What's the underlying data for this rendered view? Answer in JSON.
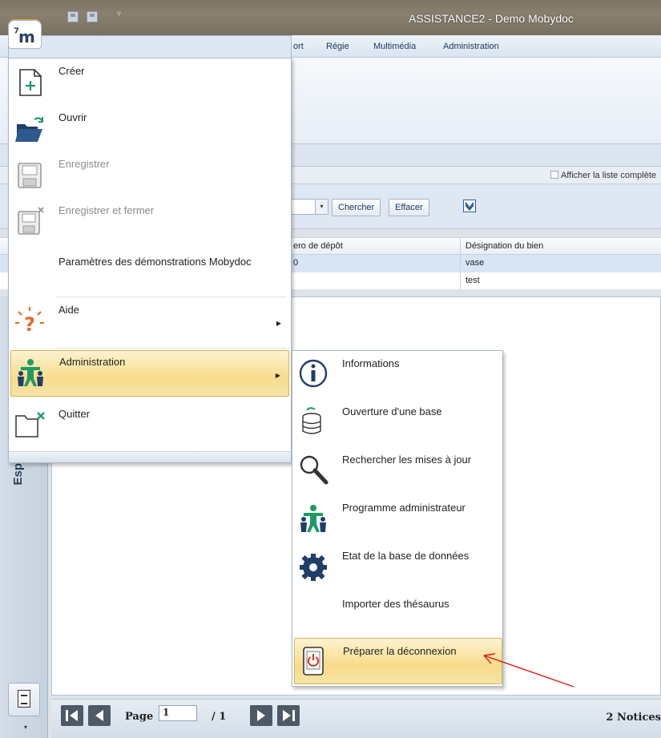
{
  "window": {
    "title": "ASSISTANCE2 - Demo Mobydoc"
  },
  "ribbon": {
    "tabs": [
      "ort",
      "Régie",
      "Multimédia",
      "Administration"
    ]
  },
  "filters": {
    "show_all_label": "Afficher la liste complète",
    "search_label": "Chercher",
    "clear_label": "Effacer"
  },
  "grid": {
    "columns": [
      "ero de dépôt",
      "Désignation du bien"
    ],
    "rows": [
      [
        "0",
        "vase"
      ],
      [
        "",
        "test"
      ]
    ]
  },
  "side": {
    "vertical_label": "Esp"
  },
  "app_menu": {
    "logo": "m",
    "logo_sup": "7",
    "items": [
      {
        "label": "Créer"
      },
      {
        "label": "Ouvrir"
      },
      {
        "label": "Enregistrer"
      },
      {
        "label": "Enregistrer et fermer"
      },
      {
        "label": "Paramètres des démonstrations Mobydoc"
      },
      {
        "label": "Aide"
      },
      {
        "label": "Administration"
      },
      {
        "label": "Quitter"
      }
    ]
  },
  "admin_submenu": {
    "items": [
      {
        "label": "Informations"
      },
      {
        "label": "Ouverture d'une base"
      },
      {
        "label": "Rechercher les mises à jour"
      },
      {
        "label": "Programme administrateur"
      },
      {
        "label": "Etat de la base de données"
      },
      {
        "label": "Importer des thésaurus"
      },
      {
        "label": "Préparer la déconnexion"
      }
    ]
  },
  "pager": {
    "page_label": "Page",
    "current_page": "1",
    "total_pages": "/ 1",
    "notices": "2 Notices"
  },
  "colors": {
    "highlight": "#f8dc8c",
    "accent": "#2f5d9a",
    "icon_green": "#1f9a66",
    "annotation_red": "#e01818"
  }
}
